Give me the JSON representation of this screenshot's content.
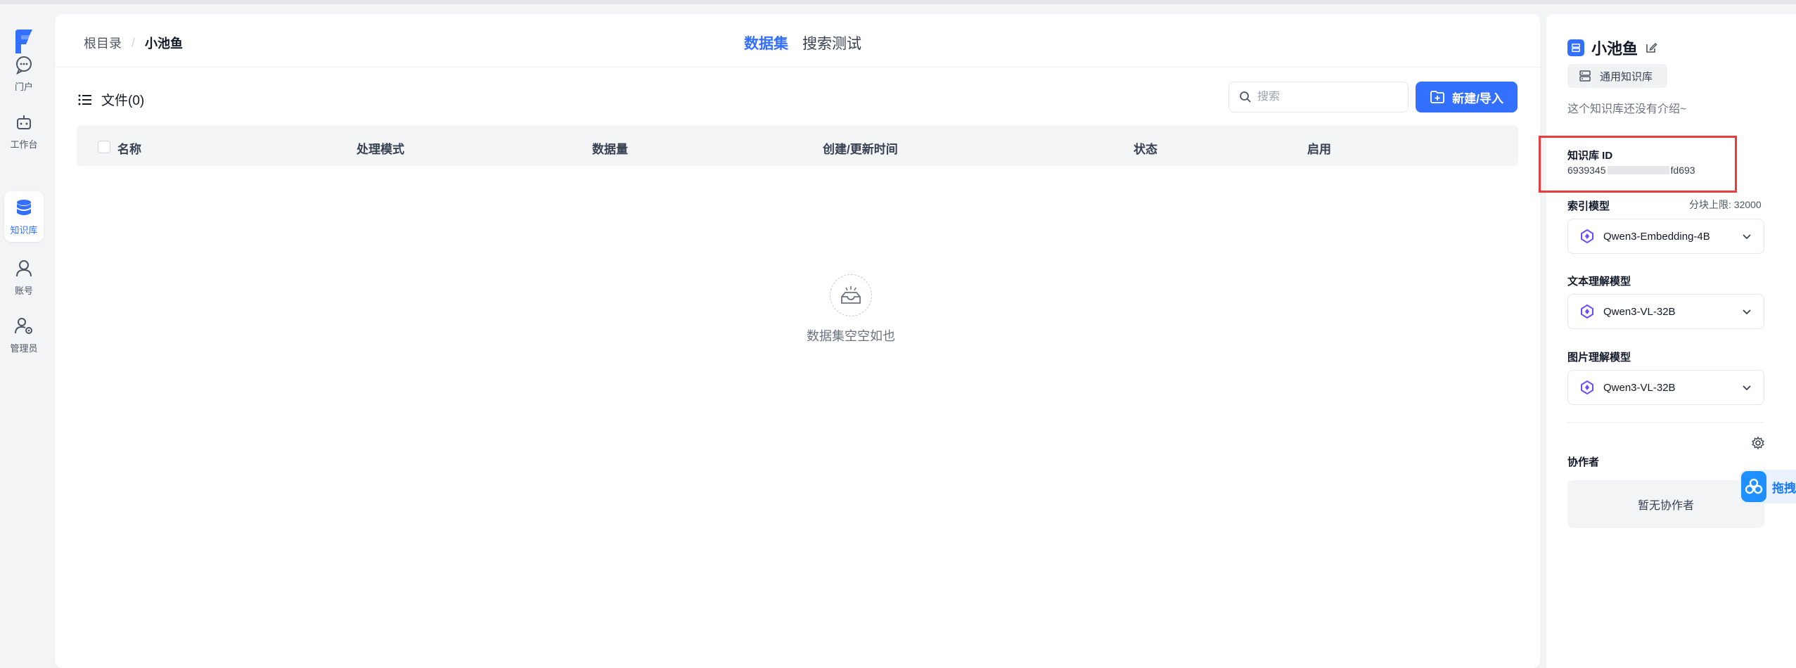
{
  "nav": {
    "items": [
      {
        "label": "门户",
        "icon": "chat-bubble-icon"
      },
      {
        "label": "工作台",
        "icon": "robot-icon"
      },
      {
        "label": "知识库",
        "icon": "database-icon",
        "active": true
      },
      {
        "label": "账号",
        "icon": "user-icon"
      },
      {
        "label": "管理员",
        "icon": "admin-gear-icon"
      }
    ]
  },
  "breadcrumb": {
    "root": "根目录",
    "separator": "/",
    "current": "小池鱼"
  },
  "tabs": [
    {
      "label": "数据集",
      "active": true
    },
    {
      "label": "搜索测试",
      "active": false
    }
  ],
  "files": {
    "title": "文件(0)",
    "search_placeholder": "搜索",
    "new_button": "新建/导入",
    "columns": [
      "名称",
      "处理模式",
      "数据量",
      "创建/更新时间",
      "状态",
      "启用"
    ],
    "empty_text": "数据集空空如也"
  },
  "side": {
    "kb_name": "小池鱼",
    "kb_type": "通用知识库",
    "intro": "这个知识库还没有介绍~",
    "id_label": "知识库 ID",
    "id_prefix": "6939345",
    "id_suffix": "fd693",
    "index_model_label": "索引模型",
    "chunk_limit": "分块上限: 32000",
    "index_model": "Qwen3-Embedding-4B",
    "text_model_label": "文本理解模型",
    "text_model": "Qwen3-VL-32B",
    "image_model_label": "图片理解模型",
    "image_model": "Qwen3-VL-32B",
    "collab_label": "协作者",
    "collab_empty": "暂无协作者"
  },
  "floating_widget": {
    "label": "拖拽"
  },
  "colors": {
    "accent": "#3370ff",
    "highlight": "#ec3b3b"
  }
}
